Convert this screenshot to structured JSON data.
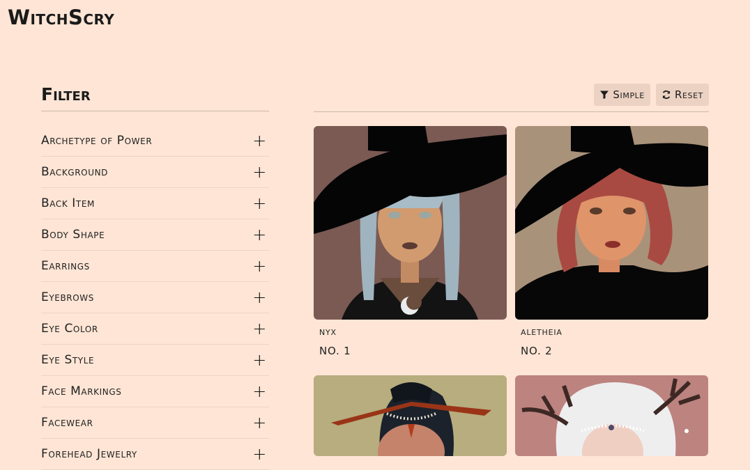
{
  "header": {
    "logo": "WitchScry"
  },
  "filter": {
    "title": "Filter",
    "items": [
      {
        "label": "Archetype of Power"
      },
      {
        "label": "Background"
      },
      {
        "label": "Back Item"
      },
      {
        "label": "Body Shape"
      },
      {
        "label": "Earrings"
      },
      {
        "label": "Eyebrows"
      },
      {
        "label": "Eye Color"
      },
      {
        "label": "Eye Style"
      },
      {
        "label": "Face Markings"
      },
      {
        "label": "Facewear"
      },
      {
        "label": "Forehead Jewelry"
      }
    ],
    "expand_icon": "plus-icon"
  },
  "toolbar": {
    "simple_label": "Simple",
    "reset_label": "Reset"
  },
  "cards": [
    {
      "name": "NYX",
      "number": "NO. 1",
      "bg": "#7b5a54"
    },
    {
      "name": "ALETHEIA",
      "number": "NO. 2",
      "bg": "#a9927a"
    },
    {
      "name": "",
      "number": "",
      "bg": "#b7ad7e"
    },
    {
      "name": "",
      "number": "",
      "bg": "#bd837f"
    }
  ]
}
